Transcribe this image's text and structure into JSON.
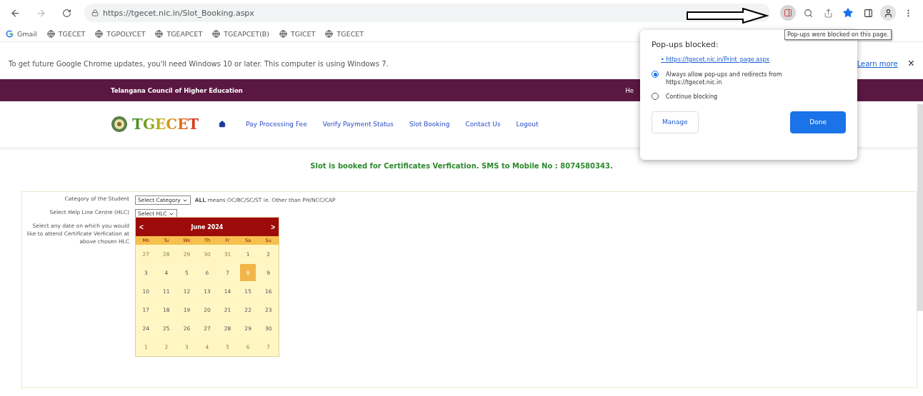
{
  "browser": {
    "url": "https://tgecet.nic.in/Slot_Booking.aspx",
    "bookmarks": [
      "Gmail",
      "TGECET",
      "TGPOLYCET",
      "TGEAPCET",
      "TGEAPCET(B)",
      "TGICET",
      "TGECET"
    ],
    "infobar": {
      "message": "To get future Google Chrome updates, you'll need Windows 10 or later. This computer is using Windows 7.",
      "link": "Learn more",
      "close": "×"
    },
    "tooltip": "Pop-ups were blocked on this page."
  },
  "popup": {
    "title": "Pop-ups blocked:",
    "link": "• https://tgecet.nic.in/Print_page.aspx",
    "options": [
      {
        "label": "Always allow pop-ups and redirects from https://tgecet.nic.in",
        "selected": true
      },
      {
        "label": "Continue blocking",
        "selected": false
      }
    ],
    "buttons": [
      {
        "label": "Manage",
        "kind": "secondary"
      },
      {
        "label": "Done",
        "kind": "primary"
      }
    ]
  },
  "site": {
    "council": "Telangana Council of Higher Education",
    "header_right": "He",
    "logo": "TGECET",
    "nav": [
      "Pay Processing Fee",
      "Verify Payment Status",
      "Slot Booking",
      "Contact Us",
      "Logout"
    ]
  },
  "message": "Slot is booked for Certificates Verfication. SMS to Mobile No : 8074580343.",
  "form": {
    "rows": [
      {
        "label": "Category of the Student",
        "select": "Select Category",
        "note": "**ALL** means OC/BC/SC/ST ie. Other than PH/NCC/CAP"
      },
      {
        "label": "Select Help Line Centre (HLC)",
        "select": "Select HLC"
      },
      {
        "label": "Select any date on which you would like to attend Certificate Verfication at above chosen HLC"
      }
    ],
    "calendar": {
      "prev": "<",
      "title": "June 2024",
      "next": ">",
      "weekdays": [
        "Mo",
        "Tu",
        "We",
        "Th",
        "Fr",
        "Sa",
        "Su"
      ],
      "weeks": [
        [
          {
            "day": "27",
            "other_month": true,
            "selected": false
          },
          {
            "day": "28",
            "other_month": true,
            "selected": false
          },
          {
            "day": "29",
            "other_month": true,
            "selected": false
          },
          {
            "day": "30",
            "other_month": true,
            "selected": false
          },
          {
            "day": "31",
            "other_month": true,
            "selected": false
          },
          {
            "day": "1",
            "other_month": false,
            "selected": false
          },
          {
            "day": "2",
            "other_month": false,
            "selected": false
          }
        ],
        [
          {
            "day": "3",
            "other_month": false,
            "selected": false
          },
          {
            "day": "4",
            "other_month": false,
            "selected": false
          },
          {
            "day": "5",
            "other_month": false,
            "selected": false
          },
          {
            "day": "6",
            "other_month": false,
            "selected": false
          },
          {
            "day": "7",
            "other_month": false,
            "selected": false
          },
          {
            "day": "8",
            "other_month": false,
            "selected": true
          },
          {
            "day": "9",
            "other_month": false,
            "selected": false
          }
        ],
        [
          {
            "day": "10",
            "other_month": false,
            "selected": false
          },
          {
            "day": "11",
            "other_month": false,
            "selected": false
          },
          {
            "day": "12",
            "other_month": false,
            "selected": false
          },
          {
            "day": "13",
            "other_month": false,
            "selected": false
          },
          {
            "day": "14",
            "other_month": false,
            "selected": false
          },
          {
            "day": "15",
            "other_month": false,
            "selected": false
          },
          {
            "day": "16",
            "other_month": false,
            "selected": false
          }
        ],
        [
          {
            "day": "17",
            "other_month": false,
            "selected": false
          },
          {
            "day": "18",
            "other_month": false,
            "selected": false
          },
          {
            "day": "19",
            "other_month": false,
            "selected": false
          },
          {
            "day": "20",
            "other_month": false,
            "selected": false
          },
          {
            "day": "21",
            "other_month": false,
            "selected": false
          },
          {
            "day": "22",
            "other_month": false,
            "selected": false
          },
          {
            "day": "23",
            "other_month": false,
            "selected": false
          }
        ],
        [
          {
            "day": "24",
            "other_month": false,
            "selected": false
          },
          {
            "day": "25",
            "other_month": false,
            "selected": false
          },
          {
            "day": "26",
            "other_month": false,
            "selected": false
          },
          {
            "day": "27",
            "other_month": false,
            "selected": false
          },
          {
            "day": "28",
            "other_month": false,
            "selected": false
          },
          {
            "day": "29",
            "other_month": false,
            "selected": false
          },
          {
            "day": "30",
            "other_month": false,
            "selected": false
          }
        ],
        [
          {
            "day": "1",
            "other_month": true,
            "selected": false
          },
          {
            "day": "2",
            "other_month": true,
            "selected": false
          },
          {
            "day": "3",
            "other_month": true,
            "selected": false
          },
          {
            "day": "4",
            "other_month": true,
            "selected": false
          },
          {
            "day": "5",
            "other_month": true,
            "selected": false
          },
          {
            "day": "6",
            "other_month": true,
            "selected": false
          },
          {
            "day": "7",
            "other_month": true,
            "selected": false
          }
        ]
      ]
    }
  }
}
